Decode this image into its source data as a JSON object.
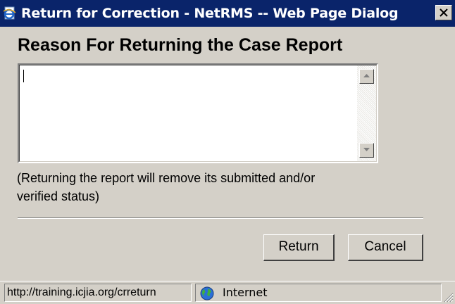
{
  "window": {
    "title": "Return for Correction - NetRMS -- Web Page Dialog",
    "title_icon": "ie-page-icon",
    "close_icon": "close-icon"
  },
  "dialog": {
    "heading": "Reason For Returning the Case Report",
    "reason_value": "",
    "note_line1": "(Returning the report will remove its submitted and/or",
    "note_line2": "verified status)",
    "return_label": "Return",
    "cancel_label": "Cancel"
  },
  "statusbar": {
    "url": "http://training.icjia.org/crreturn",
    "zone_label": "Internet",
    "zone_icon": "globe-icon"
  },
  "colors": {
    "titlebar": "#0a246a",
    "face": "#d4d0c8"
  }
}
